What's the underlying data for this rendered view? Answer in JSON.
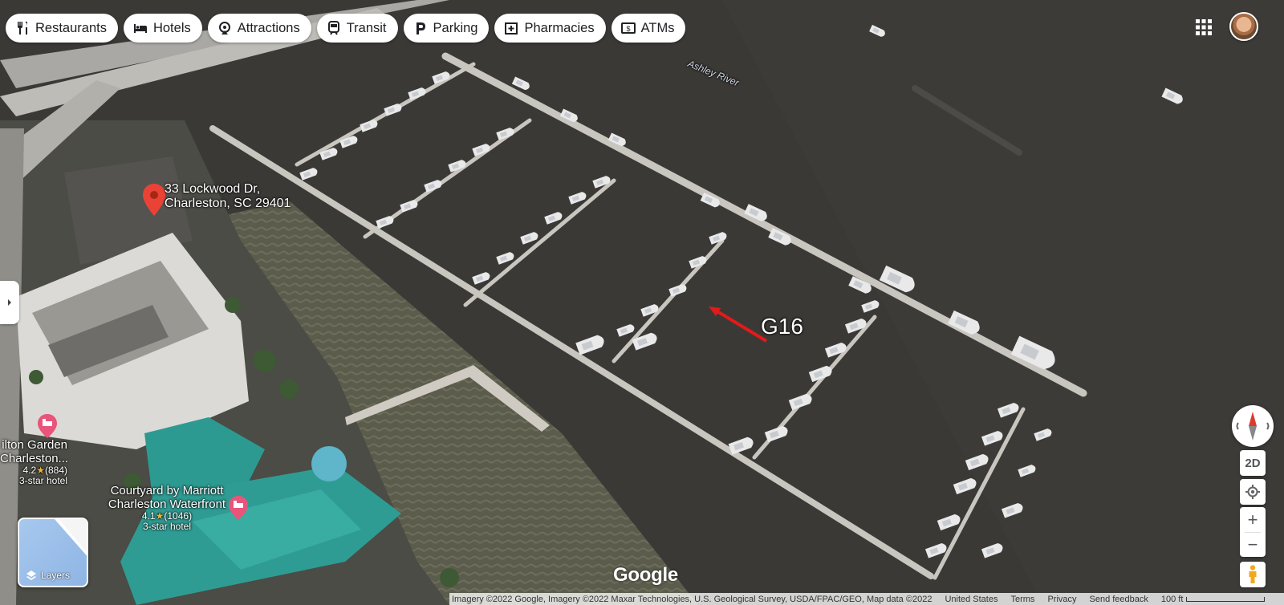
{
  "chips": [
    {
      "label": "Restaurants",
      "icon": "fork-knife-icon"
    },
    {
      "label": "Hotels",
      "icon": "bed-icon"
    },
    {
      "label": "Attractions",
      "icon": "attraction-icon"
    },
    {
      "label": "Transit",
      "icon": "train-icon"
    },
    {
      "label": "Parking",
      "icon": "parking-icon"
    },
    {
      "label": "Pharmacies",
      "icon": "pharmacy-icon"
    },
    {
      "label": "ATMs",
      "icon": "atm-icon"
    }
  ],
  "map": {
    "address_line1": "33 Lockwood Dr,",
    "address_line2": "Charleston, SC 29401",
    "river_label": "Ashley River",
    "annotation": "G16",
    "hotels": [
      {
        "name1": "ilton Garden",
        "name2": "Charleston...",
        "rating": "4.2",
        "reviews": "(884)",
        "type": "3-star hotel"
      },
      {
        "name1": "Courtyard by Marriott",
        "name2": "Charleston Waterfront",
        "rating": "4.1",
        "reviews": "(1046)",
        "type": "3-star hotel"
      }
    ],
    "star": "★"
  },
  "controls": {
    "view_toggle": "2D",
    "zoom_in": "+",
    "zoom_out": "−",
    "layers_label": "Layers"
  },
  "logo": "Google",
  "footer": {
    "attribution": "Imagery ©2022 Google, Imagery ©2022 Maxar Technologies, U.S. Geological Survey, USDA/FPAC/GEO, Map data ©2022",
    "country": "United States",
    "terms": "Terms",
    "privacy": "Privacy",
    "feedback": "Send feedback",
    "scale": "100 ft"
  },
  "colors": {
    "water": "#3a3835",
    "dock": "#c9c6bf",
    "roof_teal": "#2f9c93",
    "pin_red": "#ea4335",
    "pin_hotel": "#e8547a"
  }
}
